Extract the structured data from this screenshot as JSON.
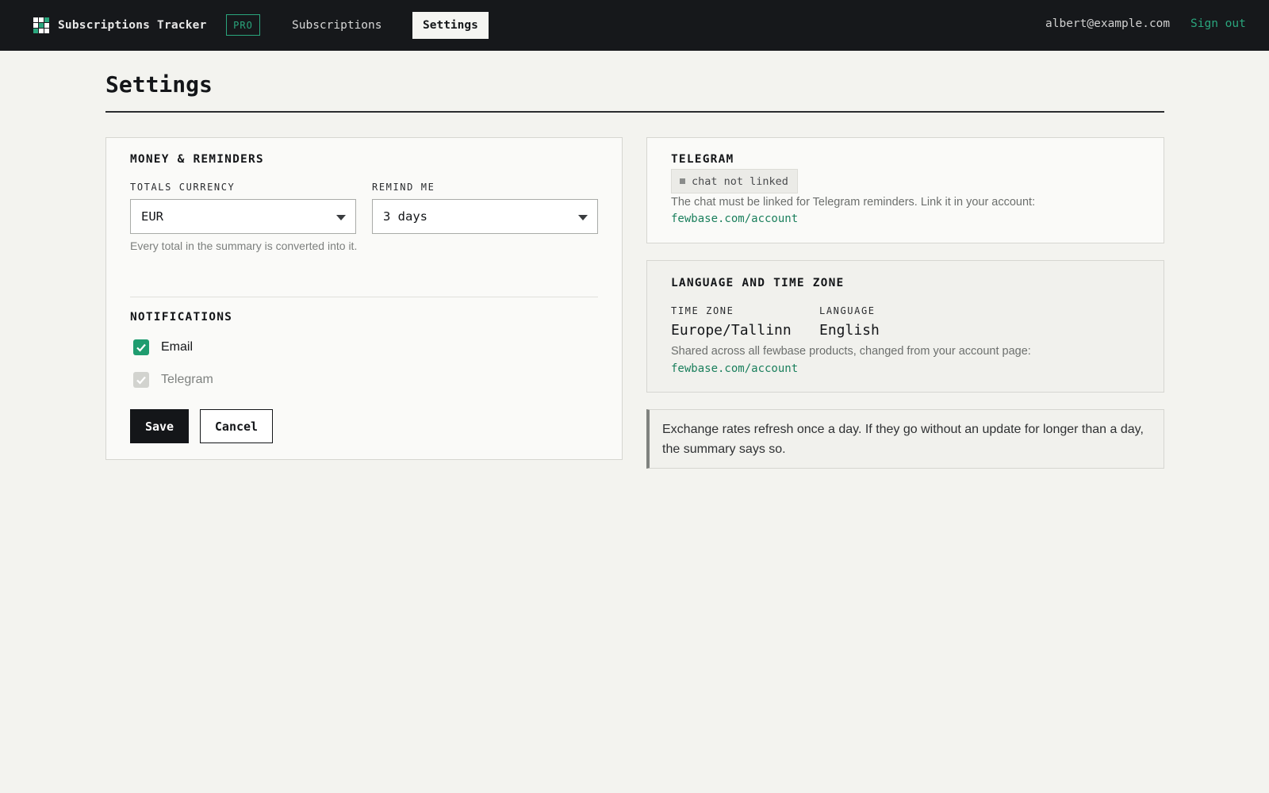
{
  "header": {
    "app_name": "Subscriptions Tracker",
    "badge": "PRO",
    "nav": [
      {
        "label": "Subscriptions",
        "active": false
      },
      {
        "label": "Settings",
        "active": true
      }
    ],
    "user_email": "albert@example.com",
    "sign_out": "Sign out"
  },
  "page": {
    "title": "Settings"
  },
  "money": {
    "heading": "MONEY & REMINDERS",
    "currency_label": "TOTALS CURRENCY",
    "currency_value": "EUR",
    "currency_help": "Every total in the summary is converted into it.",
    "remind_label": "REMIND ME",
    "remind_value": "3 days"
  },
  "notifications": {
    "heading": "NOTIFICATIONS",
    "options": [
      {
        "label": "Email",
        "checked": true,
        "disabled": false
      },
      {
        "label": "Telegram",
        "checked": true,
        "disabled": true
      }
    ]
  },
  "actions": {
    "save": "Save",
    "cancel": "Cancel"
  },
  "telegram": {
    "heading": "TELEGRAM",
    "status": "chat not linked",
    "message": "The chat must be linked for Telegram reminders. Link it in your account:",
    "link": "fewbase.com/account"
  },
  "locale": {
    "heading": "LANGUAGE AND TIME ZONE",
    "timezone_label": "TIME ZONE",
    "timezone_value": "Europe/Tallinn",
    "language_label": "LANGUAGE",
    "language_value": "English",
    "message": "Shared across all fewbase products, changed from your account page:",
    "link": "fewbase.com/account"
  },
  "note": {
    "text": "Exchange rates refresh once a day. If they go without an update for longer than a day, the summary says so."
  },
  "colors": {
    "accent": "#2aa67d",
    "topbar": "#16181b",
    "background": "#f3f3ef"
  }
}
